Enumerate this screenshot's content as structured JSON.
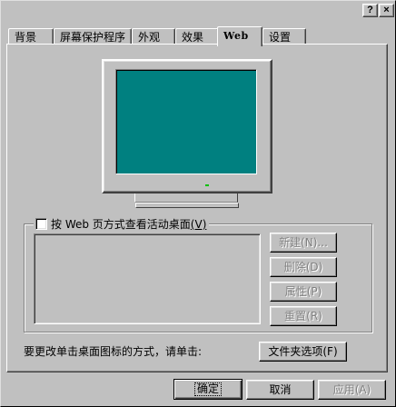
{
  "title_bar": {
    "help_label": "?",
    "close_label": "×"
  },
  "tabs": [
    {
      "label": "背景",
      "active": false
    },
    {
      "label": "屏幕保护程序",
      "active": false
    },
    {
      "label": "外观",
      "active": false
    },
    {
      "label": "效果",
      "active": false
    },
    {
      "label": "Web",
      "active": true
    },
    {
      "label": "设置",
      "active": false
    }
  ],
  "web_tab": {
    "active_desktop_checkbox": {
      "label": "按 Web 页方式查看活动桌面",
      "hotkey": "(V)",
      "checked": false
    },
    "buttons": {
      "new": {
        "label": "新建(N)...",
        "enabled": false
      },
      "delete": {
        "label": "删除(D)",
        "enabled": false
      },
      "properties": {
        "label": "属性(P)",
        "enabled": false
      },
      "reset": {
        "label": "重置(R)",
        "enabled": false
      }
    },
    "folder_options_prompt": "要更改单击桌面图标的方式，请单击:",
    "folder_options_button": "文件夹选项(F)"
  },
  "dialog_buttons": {
    "ok": "确定",
    "cancel": "取消",
    "apply": "应用(A)"
  },
  "colors": {
    "face": "#c0c0c0",
    "screen": "#008080",
    "disabled_text": "#808080"
  }
}
